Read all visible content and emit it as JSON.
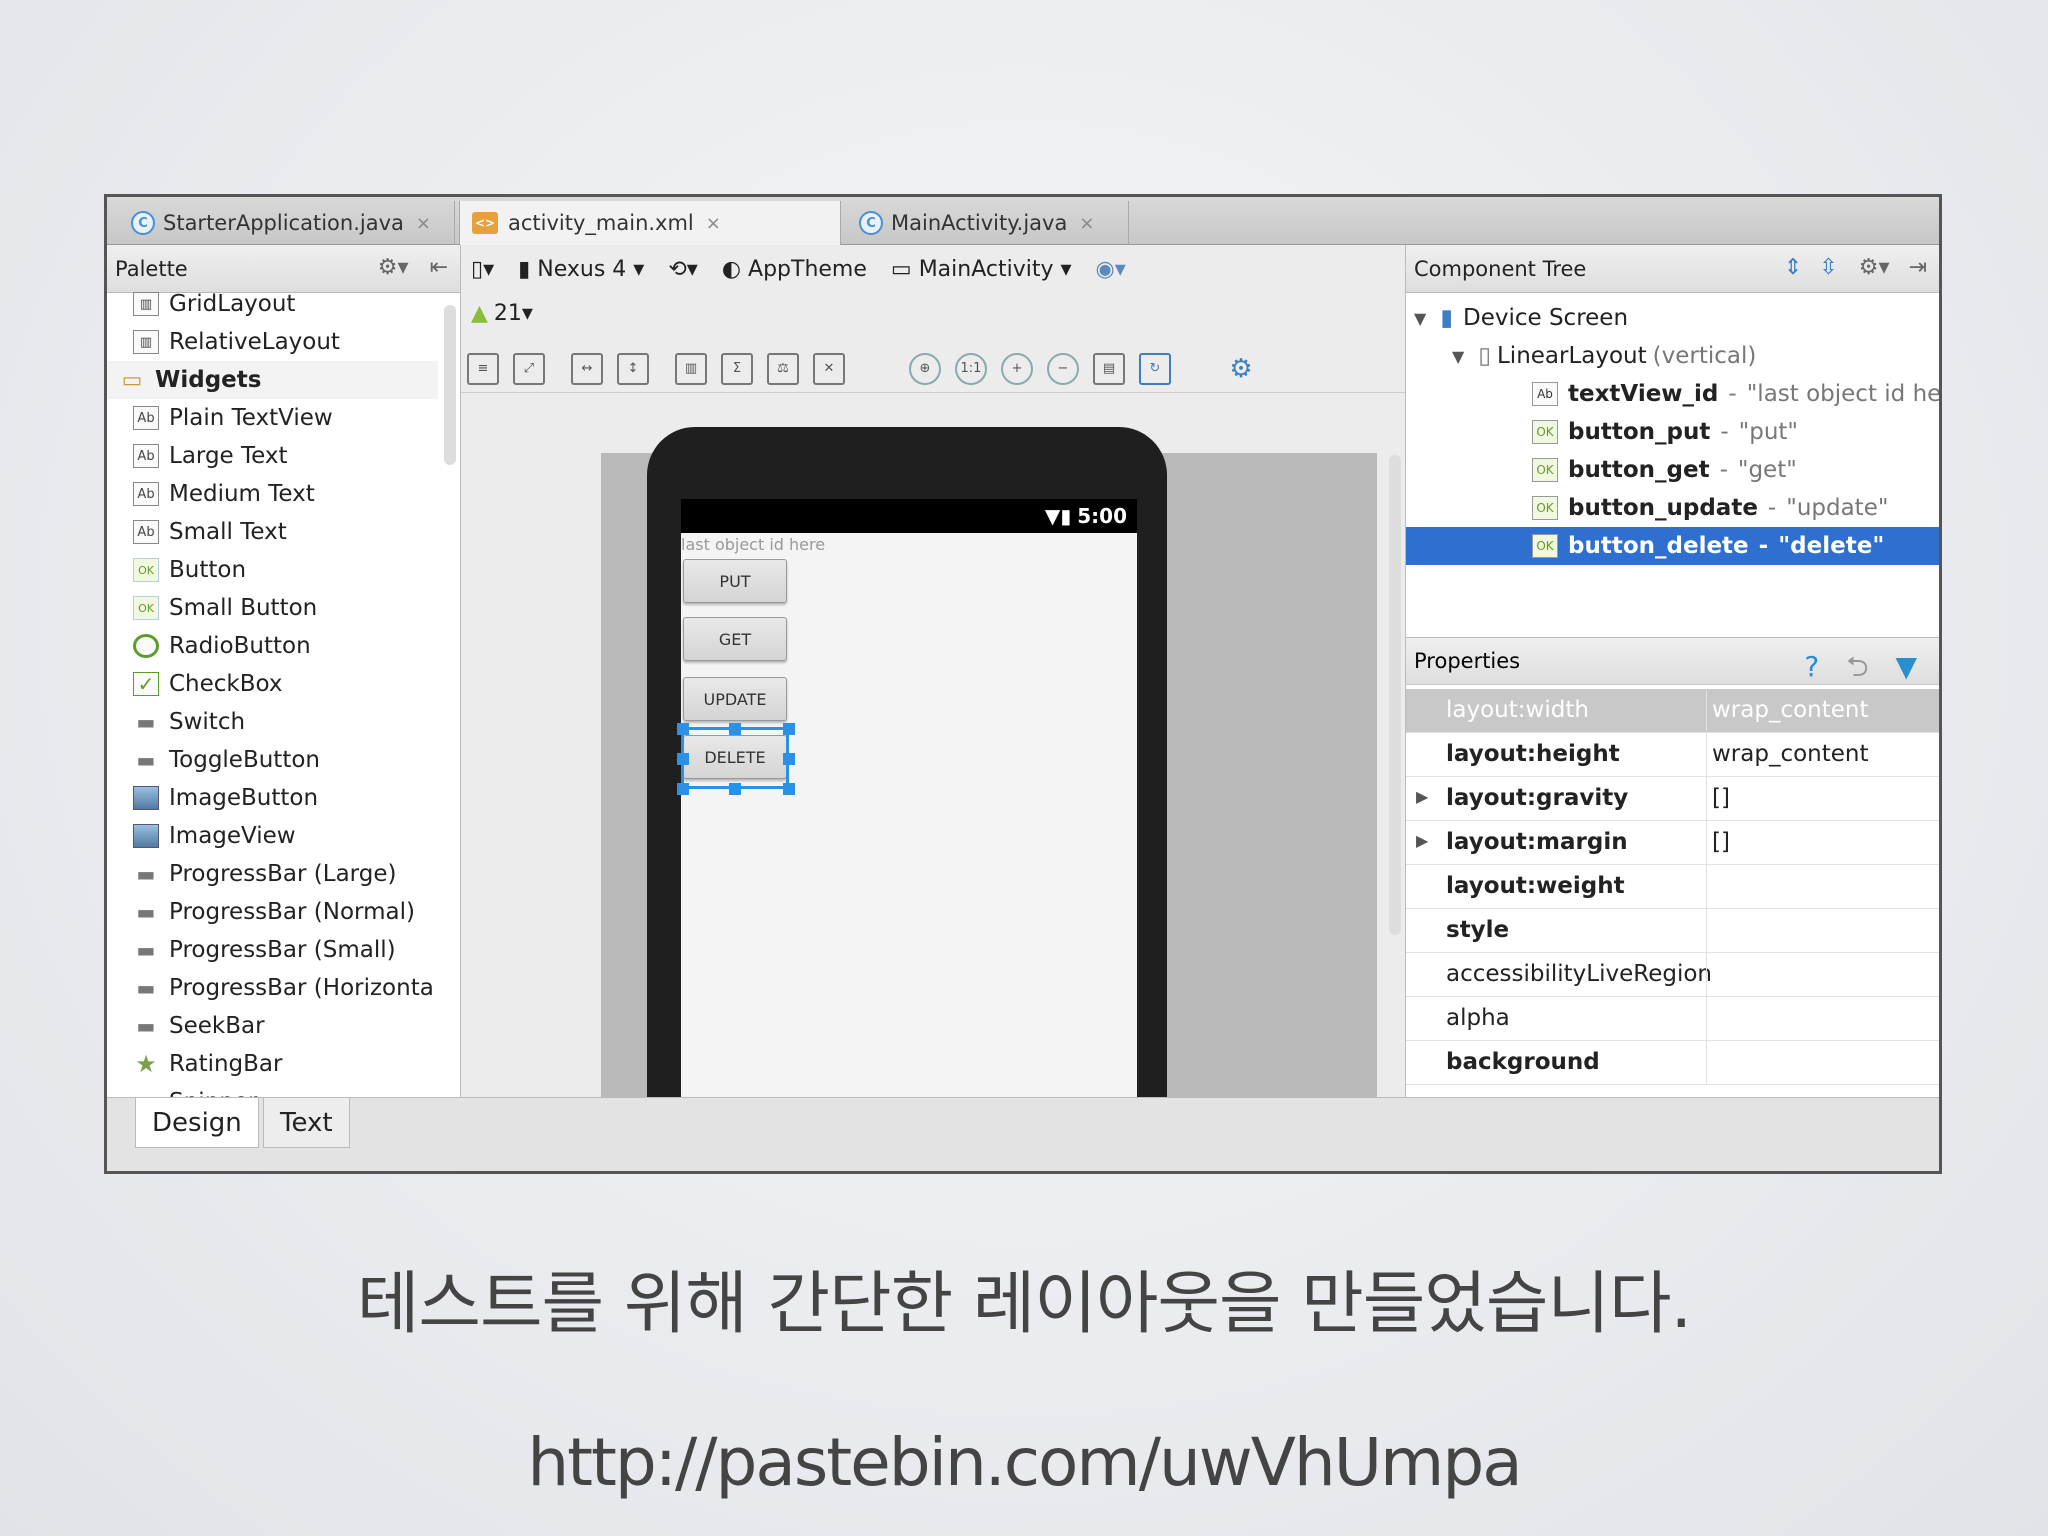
{
  "tabs": [
    {
      "icon": "C",
      "label": "StarterApplication.java",
      "close": "×"
    },
    {
      "icon": "<>",
      "label": "activity_main.xml",
      "close": "×"
    },
    {
      "icon": "C",
      "label": "MainActivity.java",
      "close": "×"
    }
  ],
  "palette": {
    "title": "Palette",
    "items": [
      {
        "label": "GridLayout",
        "kind": "layout"
      },
      {
        "label": "RelativeLayout",
        "kind": "layout"
      },
      {
        "label": "Widgets",
        "kind": "category"
      },
      {
        "label": "Plain TextView",
        "kind": "text"
      },
      {
        "label": "Large Text",
        "kind": "text"
      },
      {
        "label": "Medium Text",
        "kind": "text"
      },
      {
        "label": "Small Text",
        "kind": "text"
      },
      {
        "label": "Button",
        "kind": "ok"
      },
      {
        "label": "Small Button",
        "kind": "ok"
      },
      {
        "label": "RadioButton",
        "kind": "radio"
      },
      {
        "label": "CheckBox",
        "kind": "check"
      },
      {
        "label": "Switch",
        "kind": "bar"
      },
      {
        "label": "ToggleButton",
        "kind": "bar"
      },
      {
        "label": "ImageButton",
        "kind": "img"
      },
      {
        "label": "ImageView",
        "kind": "img"
      },
      {
        "label": "ProgressBar (Large)",
        "kind": "bar"
      },
      {
        "label": "ProgressBar (Normal)",
        "kind": "bar"
      },
      {
        "label": "ProgressBar (Small)",
        "kind": "bar"
      },
      {
        "label": "ProgressBar (Horizonta",
        "kind": "bar"
      },
      {
        "label": "SeekBar",
        "kind": "bar"
      },
      {
        "label": "RatingBar",
        "kind": "star"
      },
      {
        "label": "Spinner",
        "kind": "bar"
      }
    ]
  },
  "toolbar": {
    "device": "Nexus 4",
    "theme": "AppTheme",
    "activity": "MainActivity",
    "api": "21"
  },
  "preview": {
    "time": "5:00",
    "hint": "last object id here",
    "buttons": [
      "PUT",
      "GET",
      "UPDATE",
      "DELETE"
    ]
  },
  "component_tree": {
    "title": "Component Tree",
    "device": "Device Screen",
    "layout": "LinearLayout",
    "layout_note": "(vertical)",
    "nodes": [
      {
        "id": "textView_id",
        "sep": "-",
        "value": "\"last object id here\"",
        "icon": "Ab"
      },
      {
        "id": "button_put",
        "sep": "-",
        "value": "\"put\"",
        "icon": "OK"
      },
      {
        "id": "button_get",
        "sep": "-",
        "value": "\"get\"",
        "icon": "OK"
      },
      {
        "id": "button_update",
        "sep": "-",
        "value": "\"update\"",
        "icon": "OK"
      },
      {
        "id": "button_delete",
        "sep": "-",
        "value": "\"delete\"",
        "icon": "OK"
      }
    ]
  },
  "properties": {
    "title": "Properties",
    "rows": [
      {
        "name": "layout:width",
        "value": "wrap_content"
      },
      {
        "name": "layout:height",
        "value": "wrap_content"
      },
      {
        "name": "layout:gravity",
        "value": "[]"
      },
      {
        "name": "layout:margin",
        "value": "[]"
      },
      {
        "name": "layout:weight",
        "value": ""
      },
      {
        "name": "style",
        "value": ""
      },
      {
        "name": "accessibilityLiveRegion",
        "value": ""
      },
      {
        "name": "alpha",
        "value": ""
      },
      {
        "name": "background",
        "value": ""
      }
    ]
  },
  "bottom_tabs": [
    "Design",
    "Text"
  ],
  "caption": "테스트를 위해 간단한 레이아웃을 만들었습니다.",
  "url": "http://pastebin.com/uwVhUmpa",
  "colors": {
    "selection": "#2f6fd0",
    "accent": "#2a90e8"
  }
}
